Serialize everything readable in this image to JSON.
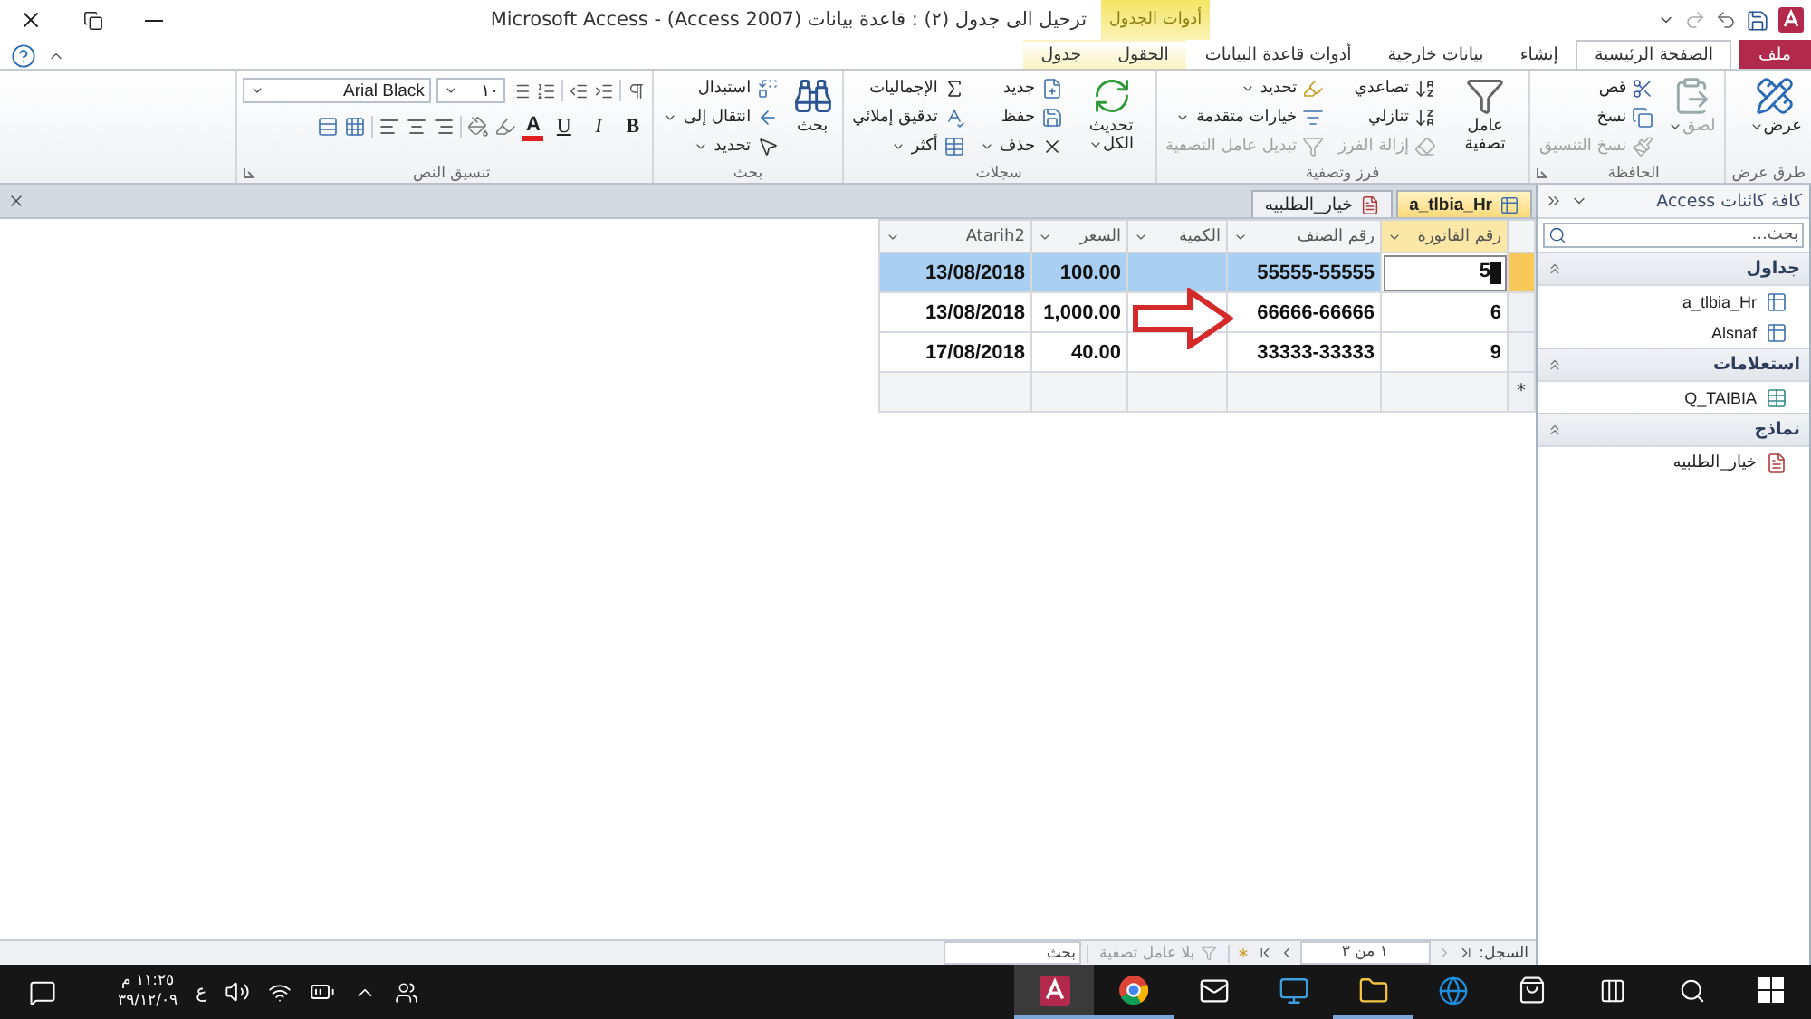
{
  "title_bar": {
    "title": "ترحيل الى جدول (٢) : قاعدة بيانات (Access 2007) - Microsoft Access",
    "context_tab": "أدوات الجدول"
  },
  "ribbon_tabs": [
    {
      "label": "ملف",
      "kind": "file",
      "selected": false
    },
    {
      "label": "الصفحة الرئيسية",
      "kind": "main",
      "selected": true
    },
    {
      "label": "إنشاء",
      "kind": "main",
      "selected": false
    },
    {
      "label": "بيانات خارجية",
      "kind": "main",
      "selected": false
    },
    {
      "label": "أدوات قاعدة البيانات",
      "kind": "main",
      "selected": false
    },
    {
      "label": "الحقول",
      "kind": "context",
      "selected": false
    },
    {
      "label": "جدول",
      "kind": "context",
      "selected": false
    }
  ],
  "ribbon_groups": [
    {
      "label": "طرق عرض",
      "launcher": false,
      "columns": [
        [
          {
            "label": "عرض",
            "kind": "large_menu",
            "disabled": false
          }
        ]
      ]
    },
    {
      "label": "الحافظة",
      "launcher": true,
      "columns": [
        [
          {
            "label": "لصق",
            "kind": "large_menu",
            "disabled": true
          }
        ],
        [
          {
            "label": "قص",
            "kind": "small",
            "disabled": false
          },
          {
            "label": "نسخ",
            "kind": "small",
            "disabled": false
          },
          {
            "label": "نسخ التنسيق",
            "kind": "small",
            "disabled": true
          }
        ]
      ]
    },
    {
      "label": "فرز وتصفية",
      "launcher": false,
      "columns": [
        [
          {
            "label": "عامل تصفية",
            "kind": "large",
            "disabled": false
          }
        ],
        [
          {
            "label": "تصاعدي",
            "kind": "small",
            "disabled": false
          },
          {
            "label": "تنازلي",
            "kind": "small",
            "disabled": false
          },
          {
            "label": "إزالة الفرز",
            "kind": "small",
            "disabled": true
          }
        ],
        [
          {
            "label": "تحديد",
            "kind": "small_menu",
            "disabled": false
          },
          {
            "label": "خيارات متقدمة",
            "kind": "small_menu",
            "disabled": false
          },
          {
            "label": "تبديل عامل التصفية",
            "kind": "small",
            "disabled": true
          }
        ]
      ]
    },
    {
      "label": "سجلات",
      "launcher": false,
      "columns": [
        [
          {
            "label": "تحديث الكل",
            "kind": "large_menu",
            "disabled": false
          }
        ],
        [
          {
            "label": "جديد",
            "kind": "small",
            "disabled": false
          },
          {
            "label": "حفظ",
            "kind": "small",
            "disabled": false
          },
          {
            "label": "حذف",
            "kind": "small_menu",
            "disabled": false
          }
        ],
        [
          {
            "label": "الإجماليات",
            "kind": "small",
            "disabled": false
          },
          {
            "label": "تدقيق إملائي",
            "kind": "small",
            "disabled": false
          },
          {
            "label": "أكثر",
            "kind": "small_menu",
            "disabled": false
          }
        ]
      ]
    },
    {
      "label": "بحث",
      "launcher": false,
      "columns": [
        [
          {
            "label": "بحث",
            "kind": "large",
            "disabled": false
          }
        ],
        [
          {
            "label": "استبدال",
            "kind": "small",
            "disabled": false
          },
          {
            "label": "انتقال إلى",
            "kind": "small_menu",
            "disabled": false
          },
          {
            "label": "تحديد",
            "kind": "small_menu",
            "disabled": false
          }
        ]
      ]
    }
  ],
  "text_format": {
    "label": "تنسيق النص",
    "launcher": true,
    "font": "Arial Black",
    "size": "١٠",
    "style_buttons": [
      {
        "label": "B",
        "kind": "bold"
      },
      {
        "label": "I",
        "kind": "italic"
      },
      {
        "label": "U",
        "kind": "underline"
      }
    ],
    "font_color": "A"
  },
  "nav_pane": {
    "title": "كافة كائنات Access",
    "search_placeholder": "بحث...",
    "groups": [
      {
        "label": "جداول",
        "kind": "tables",
        "items": [
          "a_tlbia_Hr",
          "Alsnaf"
        ]
      },
      {
        "label": "استعلامات",
        "kind": "queries",
        "items": [
          "Q_TAIBIA"
        ]
      },
      {
        "label": "نماذج",
        "kind": "forms",
        "items": [
          "خيار_الطلبيه"
        ]
      }
    ]
  },
  "doc_tabs": [
    {
      "label": "a_tlbia_Hr",
      "kind": "table",
      "selected": true
    },
    {
      "label": "خيار_الطلبيه",
      "kind": "form",
      "selected": false
    }
  ],
  "datasheet": {
    "columns": [
      {
        "label": "رقم الفاتورة",
        "selected": true
      },
      {
        "label": "رقم الصنف",
        "selected": false
      },
      {
        "label": "الكمية",
        "selected": false
      },
      {
        "label": "السعر",
        "selected": false
      },
      {
        "label": "Atarih2",
        "selected": false
      }
    ],
    "rows": [
      {
        "selected": true,
        "cells": [
          "5",
          "55555-55555",
          null,
          "100.00",
          "13/08/2018"
        ]
      },
      {
        "selected": false,
        "cells": [
          "6",
          "66666-66666",
          null,
          "1,000.00",
          "13/08/2018"
        ]
      },
      {
        "selected": false,
        "cells": [
          "9",
          "33333-33333",
          null,
          "40.00",
          "17/08/2018"
        ]
      }
    ],
    "new_row_marker": "*"
  },
  "record_bar": {
    "label": "السجل:",
    "position": "١ من ٣",
    "filter": "بلا عامل تصفية",
    "search_placeholder": "بحث"
  },
  "taskbar": {
    "language": "ع",
    "time": "١١:٢٥ م",
    "date": "٣٩/١٢/٠٩"
  }
}
